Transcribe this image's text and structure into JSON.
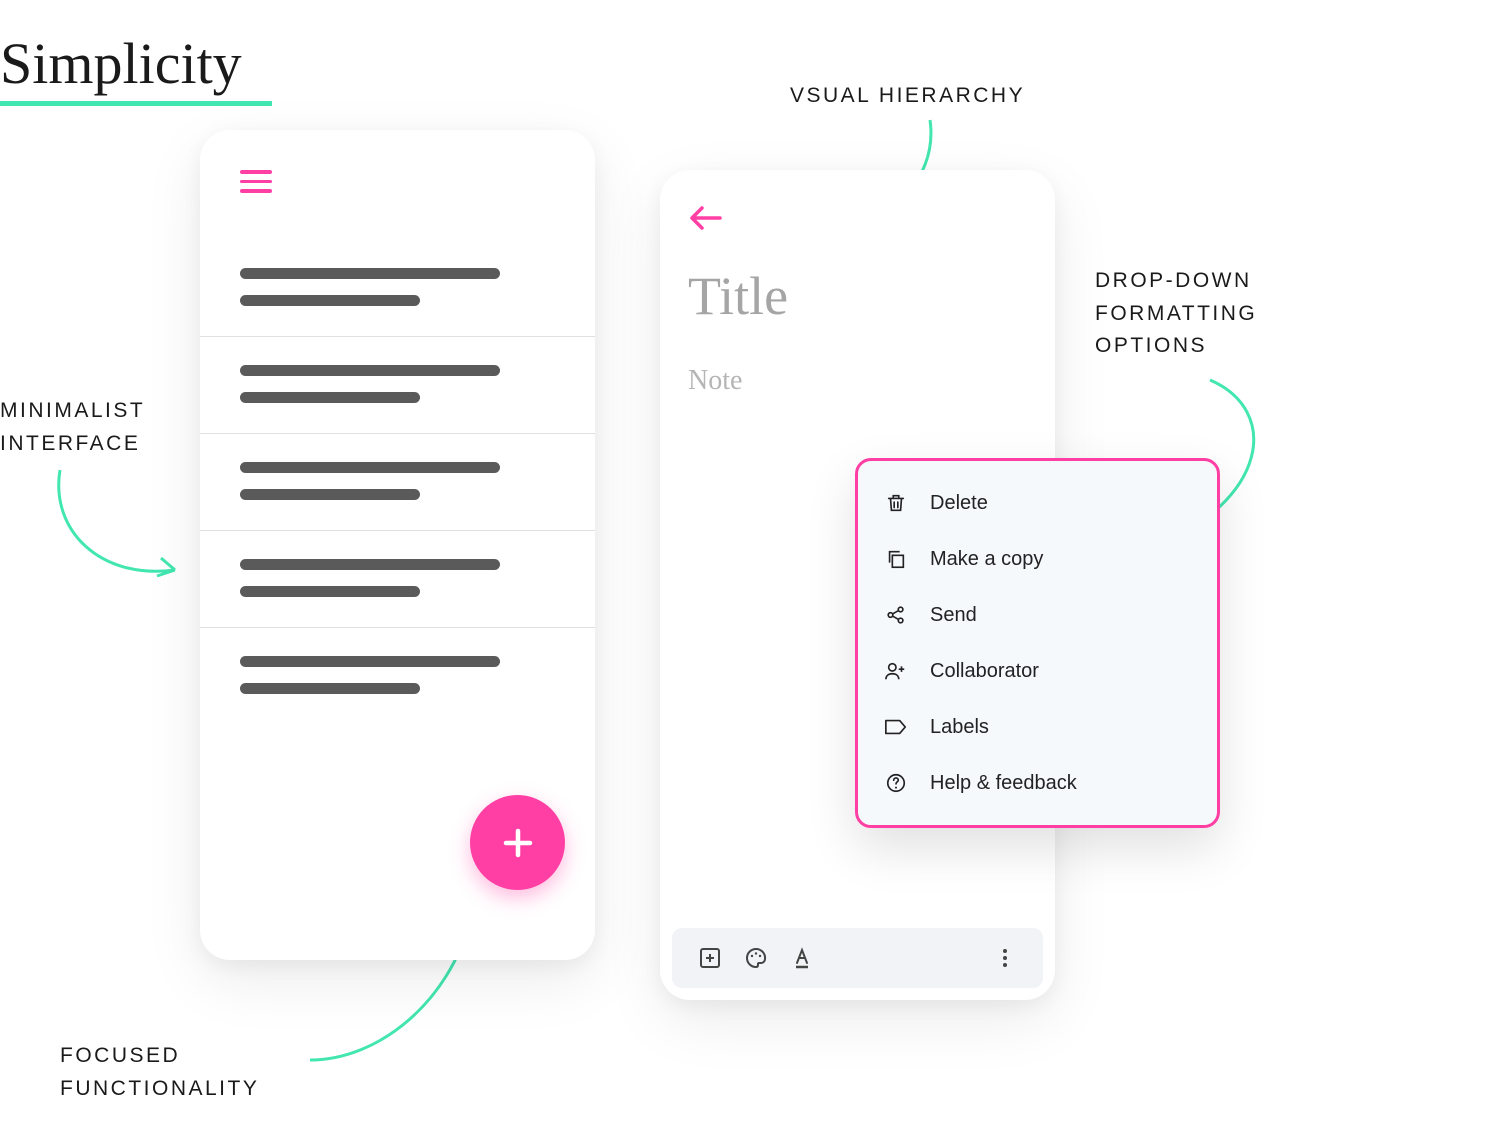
{
  "heading": "Simplicity",
  "annotations": {
    "minimalist": "MINIMALIST INTERFACE",
    "focused": "FOCUSED FUNCTIONALITY",
    "visual": "VSUAL HIERARCHY",
    "dropdown": "DROP-DOWN FORMATTING OPTIONS"
  },
  "editor": {
    "title_placeholder": "Title",
    "note_placeholder": "Note"
  },
  "dropdown": {
    "items": [
      {
        "label": "Delete",
        "icon": "trash-icon"
      },
      {
        "label": "Make a copy",
        "icon": "copy-icon"
      },
      {
        "label": "Send",
        "icon": "share-icon"
      },
      {
        "label": "Collaborator",
        "icon": "person-add-icon"
      },
      {
        "label": "Labels",
        "icon": "label-icon"
      },
      {
        "label": "Help & feedback",
        "icon": "help-icon"
      }
    ]
  },
  "colors": {
    "accent_pink": "#ff3fa4",
    "accent_mint": "#42e6b0"
  }
}
